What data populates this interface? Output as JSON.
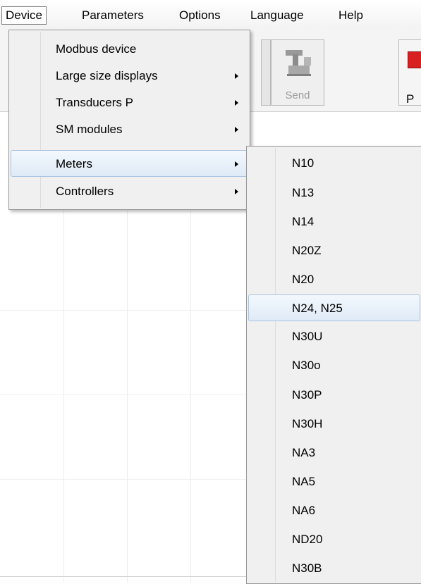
{
  "menubar": {
    "items": [
      {
        "label": "Device"
      },
      {
        "label": "Parameters"
      },
      {
        "label": "Options"
      },
      {
        "label": "Language"
      },
      {
        "label": "Help"
      }
    ]
  },
  "toolbar": {
    "send_label": "Send",
    "right_label": "P"
  },
  "device_menu": {
    "items": [
      {
        "label": "Modbus device",
        "submenu": false
      },
      {
        "label": "Large size displays",
        "submenu": true
      },
      {
        "label": "Transducers P",
        "submenu": true
      },
      {
        "label": "SM modules",
        "submenu": true
      },
      {
        "label": "Meters",
        "submenu": true,
        "highlighted": true
      },
      {
        "label": "Controllers",
        "submenu": true
      }
    ]
  },
  "meters_submenu": {
    "items": [
      {
        "label": "N10"
      },
      {
        "label": "N13"
      },
      {
        "label": "N14"
      },
      {
        "label": "N20Z"
      },
      {
        "label": "N20"
      },
      {
        "label": "N24, N25",
        "highlighted": true
      },
      {
        "label": "N30U"
      },
      {
        "label": "N30o"
      },
      {
        "label": "N30P"
      },
      {
        "label": "N30H"
      },
      {
        "label": "NA3"
      },
      {
        "label": "NA5"
      },
      {
        "label": "NA6"
      },
      {
        "label": "ND20"
      },
      {
        "label": "N30B"
      }
    ]
  },
  "colors": {
    "menu_bg": "#f0f0f0",
    "highlight_bg": "#dfeaf7",
    "highlight_border": "#a9c3e2",
    "icon_red": "#d92020"
  }
}
